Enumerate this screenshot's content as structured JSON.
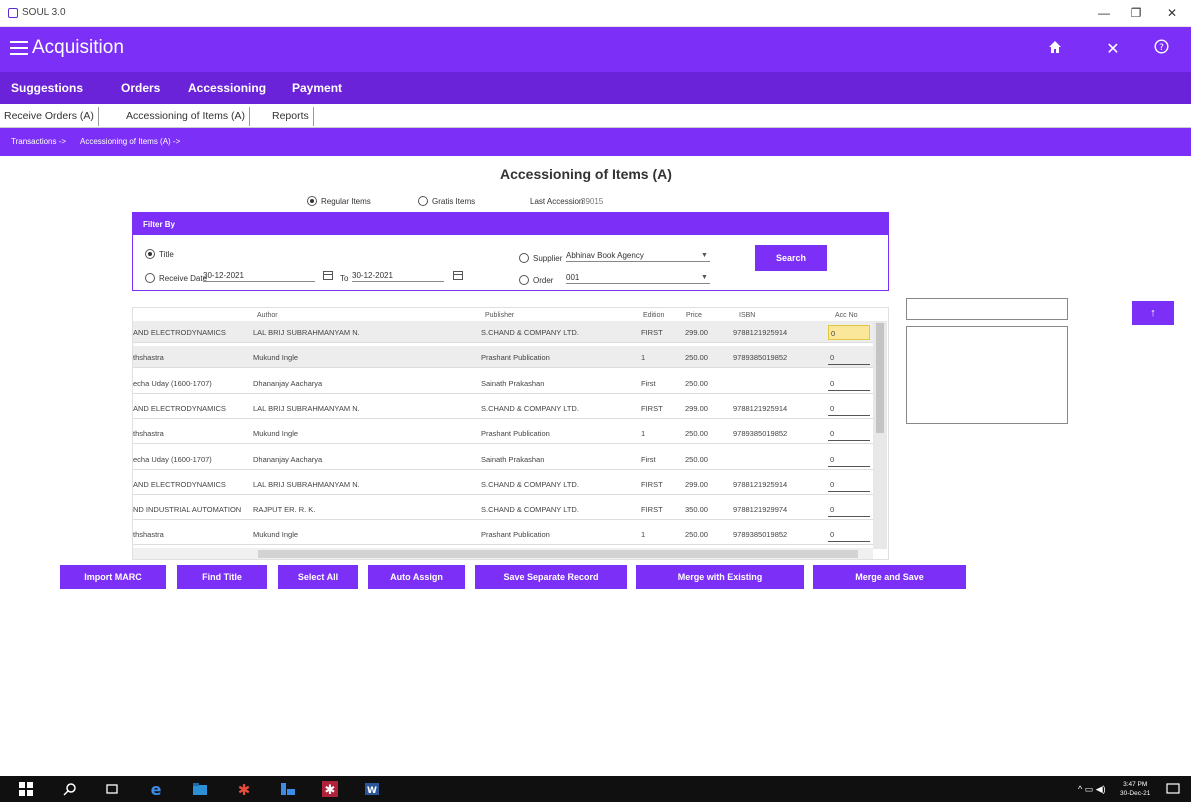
{
  "window": {
    "title": "SOUL 3.0",
    "minimize": "—",
    "maximize": "❐",
    "close": "✕"
  },
  "app": {
    "title": "Acquisition",
    "home_icon": "home-icon",
    "close_icon": "close-icon",
    "help_icon": "help-icon"
  },
  "main_menu": [
    "Suggestions",
    "Orders",
    "Accessioning",
    "Payment"
  ],
  "tabs": [
    "Receive Orders (A)",
    "Accessioning of Items (A)",
    "Reports"
  ],
  "breadcrumb": [
    "Transactions ->",
    "Accessioning of Items (A) ->"
  ],
  "page": {
    "title": "Accessioning of Items (A)",
    "regular_items": "Regular Items",
    "gratis_items": "Gratis Items",
    "last_accession_label": "Last Accession",
    "last_accession_value": "39015"
  },
  "filter": {
    "header": "Filter By",
    "title_label": "Title",
    "receive_date_label": "Receive Date",
    "date_from": "30-12-2021",
    "to_label": "To",
    "date_to": "30-12-2021",
    "supplier_label": "Supplier",
    "supplier_value": "Abhinav Book Agency",
    "order_label": "Order",
    "order_value": "001",
    "search_button": "Search"
  },
  "grid": {
    "headers": [
      "Author",
      "Publisher",
      "Edition",
      "Price",
      "ISBN",
      "Acc No"
    ],
    "rows": [
      [
        "AND ELECTRODYNAMICS",
        "LAL BRIJ SUBRAHMANYAM  N.",
        "S.CHAND & COMPANY LTD.",
        "FIRST",
        "299.00",
        "9788121925914",
        "0"
      ],
      [
        "thshastra",
        "Mukund Ingle",
        "Prashant Publication",
        "1",
        "250.00",
        "9789385019852",
        "0"
      ],
      [
        "echa Uday (1600-1707)",
        "Dhananjay Aacharya",
        "Sainath Prakashan",
        "First",
        "250.00",
        "",
        "0"
      ],
      [
        "AND ELECTRODYNAMICS",
        "LAL BRIJ SUBRAHMANYAM  N.",
        "S.CHAND & COMPANY LTD.",
        "FIRST",
        "299.00",
        "9788121925914",
        "0"
      ],
      [
        "thshastra",
        "Mukund Ingle",
        "Prashant Publication",
        "1",
        "250.00",
        "9789385019852",
        "0"
      ],
      [
        "echa Uday (1600-1707)",
        "Dhananjay Aacharya",
        "Sainath Prakashan",
        "First",
        "250.00",
        "",
        "0"
      ],
      [
        "AND ELECTRODYNAMICS",
        "LAL BRIJ SUBRAHMANYAM  N.",
        "S.CHAND & COMPANY LTD.",
        "FIRST",
        "299.00",
        "9788121925914",
        "0"
      ],
      [
        "ND INDUSTRIAL AUTOMATION",
        "RAJPUT ER. R. K.",
        "S.CHAND & COMPANY LTD.",
        "FIRST",
        "350.00",
        "9788121929974",
        "0"
      ],
      [
        "thshastra",
        "Mukund Ingle",
        "Prashant Publication",
        "1",
        "250.00",
        "9789385019852",
        "0"
      ]
    ]
  },
  "side": {
    "arrow_button": "↑"
  },
  "actions": [
    "Import MARC",
    "Find Title",
    "Select All",
    "Auto Assign",
    "Save Separate Record",
    "Merge with Existing",
    "Merge and Save"
  ],
  "taskbar": {
    "time": "3:47 PM",
    "date": "30-Dec-21"
  }
}
